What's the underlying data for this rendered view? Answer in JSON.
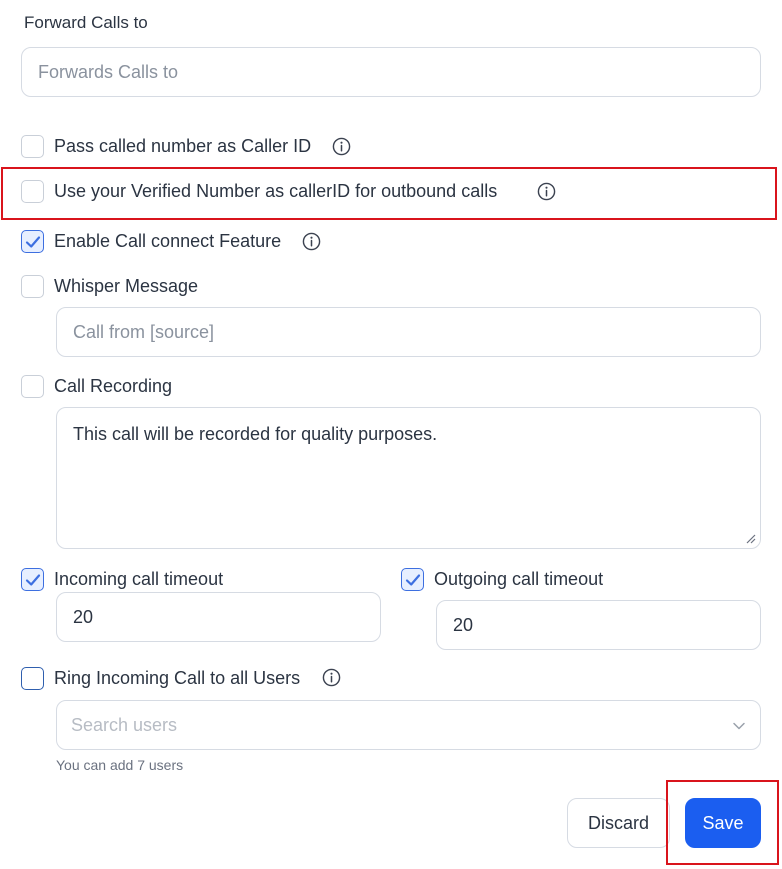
{
  "forward": {
    "label": "Forward Calls to",
    "placeholder": "Forwards Calls to"
  },
  "options": [
    {
      "label": "Pass called number as Caller ID",
      "checked": false,
      "has_info": true
    },
    {
      "label": "Use your Verified Number as callerID for outbound calls",
      "checked": false,
      "has_info": true
    },
    {
      "label": "Enable Call connect Feature",
      "checked": true,
      "has_info": true
    },
    {
      "label": "Whisper Message",
      "checked": false,
      "has_info": false
    },
    {
      "label": "Call Recording",
      "checked": false,
      "has_info": false
    }
  ],
  "whisper": {
    "placeholder": "Call from [source]"
  },
  "recording": {
    "value": "This call will be recorded for quality purposes."
  },
  "incoming": {
    "label": "Incoming call timeout",
    "checked": true,
    "value": "20"
  },
  "outgoing": {
    "label": "Outgoing call timeout",
    "checked": true,
    "value": "20"
  },
  "ring_all": {
    "label": "Ring Incoming Call to all Users",
    "checked": false,
    "search_placeholder": "Search users",
    "helper": "You can add 7 users"
  },
  "actions": {
    "discard_label": "Discard",
    "save_label": "Save"
  },
  "colors": {
    "primary": "#1b5ef0",
    "highlight": "#d9141c",
    "check": "#3d6fe0"
  },
  "icons": [
    "info-icon",
    "check-icon",
    "chevron-down-icon",
    "resize-handle-icon"
  ]
}
